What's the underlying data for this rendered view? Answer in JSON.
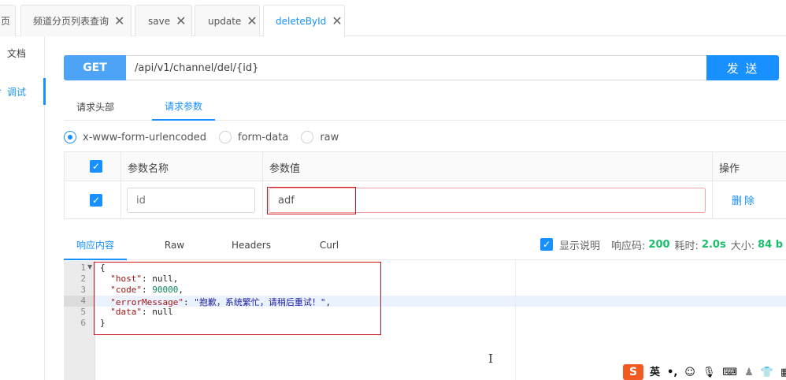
{
  "tabs": [
    {
      "label": "页",
      "closable": false
    },
    {
      "label": "频道分页列表查询",
      "closable": true
    },
    {
      "label": "save",
      "closable": true
    },
    {
      "label": "update",
      "closable": true
    },
    {
      "label": "deleteById",
      "closable": true,
      "active": true
    }
  ],
  "tab_close_glyph": "✕",
  "leftnav": {
    "doc": "文档",
    "debug": "调试",
    "debug_marker": "·"
  },
  "request": {
    "method": "GET",
    "url": "/api/v1/channel/del/{id}",
    "send": "发 送"
  },
  "request_tabs": {
    "headers": "请求头部",
    "params": "请求参数"
  },
  "body_types": {
    "urlencoded": "x-www-form-urlencoded",
    "formdata": "form-data",
    "raw": "raw",
    "selected": "x-www-form-urlencoded"
  },
  "params_table": {
    "col_name": "参数名称",
    "col_value": "参数值",
    "col_action": "操作",
    "rows": [
      {
        "name": "id",
        "value": "adf",
        "checked": true,
        "action": "删除"
      }
    ]
  },
  "response_tabs": {
    "content": "响应内容",
    "raw": "Raw",
    "headers": "Headers",
    "curl": "Curl"
  },
  "response_meta": {
    "show_desc": "显示说明",
    "code_label": "响应码:",
    "code": "200",
    "time_label": "耗时:",
    "time": "2.0s",
    "size_label": "大小:",
    "size": "84 b"
  },
  "editor": {
    "line_numbers": [
      "1",
      "2",
      "3",
      "4",
      "5",
      "6"
    ],
    "lines": {
      "l1": "{",
      "l2_key": "\"host\"",
      "l2_rest": ": null,",
      "l3_key": "\"code\"",
      "l3_sep": ": ",
      "l3_val": "90000",
      "l3_end": ",",
      "l4_key": "\"errorMessage\"",
      "l4_sep": ": ",
      "l4_val": "\"抱歉，系统繁忙，请稍后重试！\"",
      "l4_end": ",",
      "l5_key": "\"data\"",
      "l5_rest": ": null",
      "l6": "}"
    },
    "active_line": "4"
  },
  "ime": {
    "lang": "英",
    "punct": "•,",
    "emoji": "☺",
    "mic": "🎙",
    "keyboard": "⌨",
    "user": "♟",
    "shirt": "👕",
    "grid": "▦"
  },
  "colors": {
    "accent": "#1890ff",
    "method_bg": "#4da3f5",
    "success": "#19be6b",
    "highlight_box": "#d0181c",
    "ime": "#f25b22"
  }
}
